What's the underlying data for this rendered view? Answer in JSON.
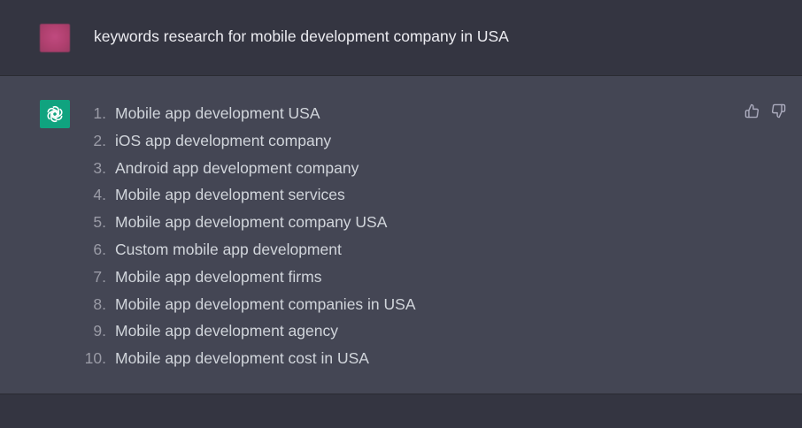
{
  "user_message": {
    "text": "keywords research for mobile development company in USA"
  },
  "assistant_message": {
    "items": [
      {
        "num": "1.",
        "text": "Mobile app development USA"
      },
      {
        "num": "2.",
        "text": "iOS app development company"
      },
      {
        "num": "3.",
        "text": "Android app development company"
      },
      {
        "num": "4.",
        "text": "Mobile app development services"
      },
      {
        "num": "5.",
        "text": "Mobile app development company USA"
      },
      {
        "num": "6.",
        "text": "Custom mobile app development"
      },
      {
        "num": "7.",
        "text": "Mobile app development firms"
      },
      {
        "num": "8.",
        "text": "Mobile app development companies in USA"
      },
      {
        "num": "9.",
        "text": "Mobile app development agency"
      },
      {
        "num": "10.",
        "text": "Mobile app development cost in USA"
      }
    ]
  },
  "icons": {
    "assistant_avatar": "openai-logo-icon",
    "thumbs_up": "thumbs-up-icon",
    "thumbs_down": "thumbs-down-icon"
  },
  "colors": {
    "background": "#343541",
    "assistant_background": "#444654",
    "assistant_avatar": "#10a37f",
    "user_avatar": "#b0406f",
    "text": "#d1d5db"
  }
}
